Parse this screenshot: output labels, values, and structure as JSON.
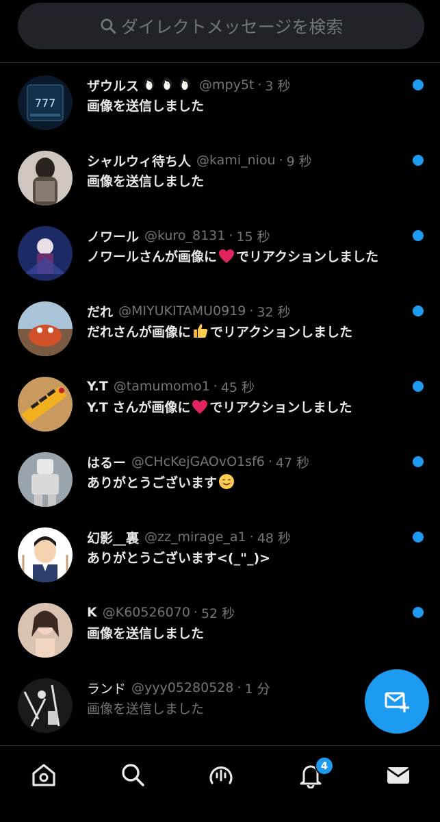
{
  "search": {
    "placeholder": "ダイレクトメッセージを検索"
  },
  "conversations": [
    {
      "name": "ザウルス",
      "handle": "@mpy5t",
      "time": "3 秒",
      "preview": "画像を送信しました",
      "unread": true
    },
    {
      "name": "シャルウィ待ち人",
      "handle": "@kami_niou",
      "time": "9 秒",
      "preview": "画像を送信しました",
      "unread": true
    },
    {
      "name": "ノワール",
      "handle": "@kuro_8131",
      "time": "15 秒",
      "preview_before": "ノワールさんが画像に",
      "preview_after": "でリアクションしました",
      "reaction": "heart",
      "unread": true
    },
    {
      "name": "だれ",
      "handle": "@MIYUKITAMU0919",
      "time": "32 秒",
      "preview_before": "だれさんが画像に",
      "preview_after": "でリアクションしました",
      "reaction": "thumbs-up",
      "unread": true
    },
    {
      "name": "Y.T",
      "handle": "@tamumomo1",
      "time": "45 秒",
      "preview_before": "Y.T さんが画像に",
      "preview_after": "でリアクションしました",
      "reaction": "heart",
      "unread": true
    },
    {
      "name": "はるー",
      "handle": "@CHcKejGAOvO1sf6",
      "time": "47 秒",
      "preview": "ありがとうございます",
      "preview_emoji": "smile",
      "unread": true
    },
    {
      "name": "幻影__裏",
      "handle": "@zz_mirage_a1",
      "time": "48 秒",
      "preview": "ありがとうございます<(_\"_)>",
      "unread": true
    },
    {
      "name": "K",
      "handle": "@K60526070",
      "time": "52 秒",
      "preview": "画像を送信しました",
      "unread": true
    },
    {
      "name": "ランド",
      "handle": "@yyy05280528",
      "time": "1 分",
      "preview": "画像を送信しました",
      "unread": false
    }
  ],
  "nav": {
    "items": [
      "home-icon",
      "search-icon",
      "spaces-icon",
      "notifications-icon",
      "messages-icon"
    ],
    "notification_count": "4"
  },
  "colors": {
    "accent": "#1d9bf0",
    "background": "#000000",
    "muted": "#71767b"
  }
}
